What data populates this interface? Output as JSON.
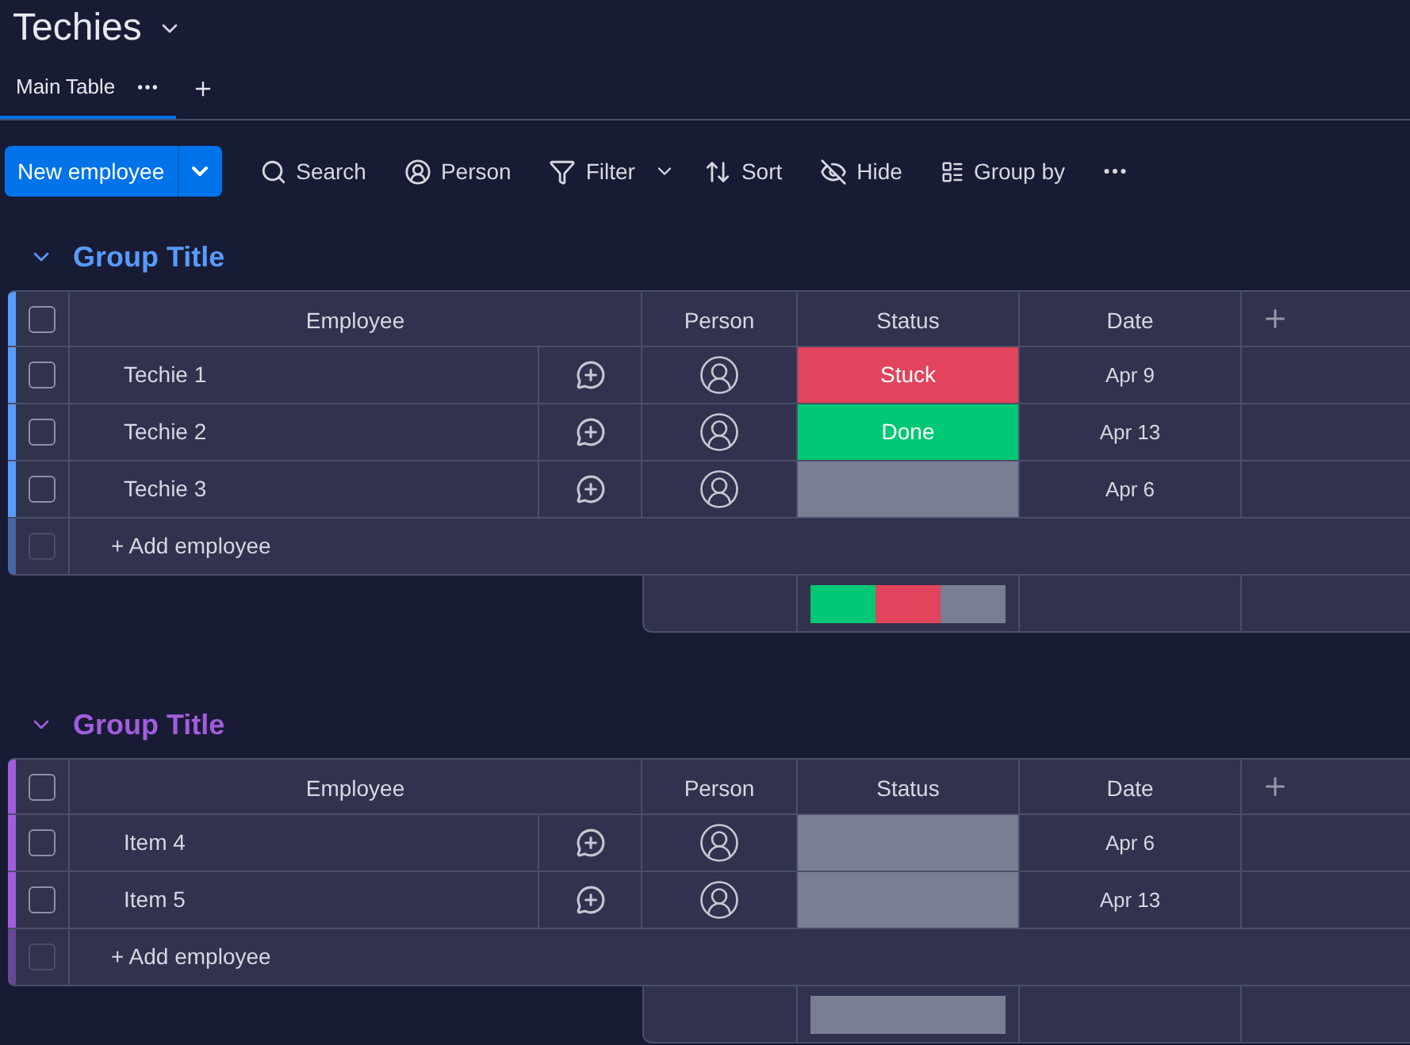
{
  "board": {
    "title": "Techies"
  },
  "tabs": [
    {
      "label": "Main Table",
      "selected": true
    }
  ],
  "toolbar": {
    "primary_button": "New employee",
    "items": [
      {
        "label": "Search",
        "kind": "search"
      },
      {
        "label": "Person",
        "kind": "person"
      },
      {
        "label": "Filter",
        "kind": "filter"
      },
      {
        "label": "Sort",
        "kind": "sort"
      },
      {
        "label": "Hide",
        "kind": "hide"
      },
      {
        "label": "Group by",
        "kind": "group"
      }
    ]
  },
  "groups": [
    {
      "title": "Group Title",
      "color": "#579bfc",
      "all_checked": false,
      "columns": [
        "Employee",
        "Person",
        "Status",
        "Date"
      ],
      "rows": [
        {
          "checked": false,
          "name": "Techie 1",
          "status": {
            "label": "Stuck",
            "color": "#e2445c"
          },
          "date": "Apr 9"
        },
        {
          "checked": false,
          "name": "Techie 2",
          "status": {
            "label": "Done",
            "color": "#00c875"
          },
          "date": "Apr 13"
        },
        {
          "checked": false,
          "name": "Techie 3",
          "status": {
            "color": "#797e93"
          },
          "date": "Apr 6"
        }
      ],
      "add_label": "+ Add employee",
      "add_checked": false,
      "summary": [
        {
          "color": "#00c875"
        },
        {
          "color": "#e2445c"
        },
        {
          "color": "#797e93"
        }
      ]
    },
    {
      "title": "Group Title",
      "color": "#a25ddc",
      "all_checked": false,
      "columns": [
        "Employee",
        "Person",
        "Status",
        "Date"
      ],
      "rows": [
        {
          "checked": false,
          "name": "Item 4",
          "status": {
            "color": "#797e93"
          },
          "date": "Apr 6"
        },
        {
          "checked": false,
          "name": "Item 5",
          "status": {
            "color": "#797e93"
          },
          "date": "Apr 13"
        }
      ],
      "add_label": "+ Add employee",
      "add_checked": false,
      "summary": [
        {
          "color": "#797e93"
        }
      ]
    }
  ]
}
